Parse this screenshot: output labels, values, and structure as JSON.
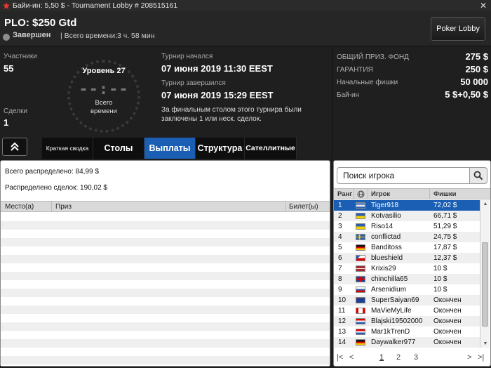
{
  "window": {
    "title": "Байи-ин: 5,50 $ - Tournament Lobby # 208515161",
    "close_label": "✕"
  },
  "header": {
    "name": "PLO: $250 Gtd",
    "status": "Завершен",
    "total_time": "| Всего времени:3 ч. 58 мин",
    "lobby_button": "Poker Lobby"
  },
  "info": {
    "participants_label": "Участники",
    "participants_value": "55",
    "deals_label": "Сделки",
    "deals_value": "1",
    "level": "Уровень 27",
    "timer": "--:--",
    "timer_caption_1": "Всего",
    "timer_caption_2": "времени",
    "started_label": "Турнир начался",
    "started_value": "07 июня 2019   11:30 EEST",
    "ended_label": "Турнир завершился",
    "ended_value": "07 июня 2019   15:29 EEST",
    "note": "За финальным столом этого турнира были заключены 1 или неск. сделок."
  },
  "prize": [
    {
      "label": "ОБЩИЙ ПРИЗ. ФОНД",
      "value": "275 $"
    },
    {
      "label": "ГАРАНТИЯ",
      "value": "250 $"
    },
    {
      "label": "Начальные фишки",
      "value": "50 000"
    },
    {
      "label": "Бай-ин",
      "value": "5 $+0,50 $"
    }
  ],
  "tabs": [
    {
      "label": "Краткая сводка",
      "active": false
    },
    {
      "label": "Столы",
      "active": false
    },
    {
      "label": "Выплаты",
      "active": true
    },
    {
      "label": "Структура",
      "active": false
    },
    {
      "label": "Сателлитные",
      "active": false
    }
  ],
  "payouts": {
    "total_distributed": "Всего распределено: 84,99 $",
    "deal_distributed": "Распределено сделок: 190,02 $",
    "columns": [
      "Место(а)",
      "Приз",
      "Билет(ы)"
    ]
  },
  "players": {
    "search_placeholder": "Поиск игрока",
    "columns": [
      "Ранг",
      "Игрок",
      "Фишки"
    ],
    "rows": [
      {
        "rank": "1",
        "name": "Tiger918",
        "chips": "72,02 $",
        "flag": "gr"
      },
      {
        "rank": "2",
        "name": "Kotvasilio",
        "chips": "66,71 $",
        "flag": "ua"
      },
      {
        "rank": "3",
        "name": "Riso14",
        "chips": "51,29 $",
        "flag": "ua"
      },
      {
        "rank": "4",
        "name": "conflictad",
        "chips": "24,75 $",
        "flag": "se"
      },
      {
        "rank": "5",
        "name": "Banditoss",
        "chips": "17,87 $",
        "flag": "de"
      },
      {
        "rank": "6",
        "name": "blueshield",
        "chips": "12,37 $",
        "flag": "cz"
      },
      {
        "rank": "7",
        "name": "Krixis29",
        "chips": "10 $",
        "flag": "lv"
      },
      {
        "rank": "8",
        "name": "chinchilla65",
        "chips": "10 $",
        "flag": "gb"
      },
      {
        "rank": "9",
        "name": "Arsenidium",
        "chips": "10 $",
        "flag": "ru"
      },
      {
        "rank": "10",
        "name": "SuperSaiyan69",
        "chips": "Окончен",
        "flag": "nz"
      },
      {
        "rank": "11",
        "name": "MaVieMyLife",
        "chips": "Окончен",
        "flag": "ca"
      },
      {
        "rank": "12",
        "name": "Blajski19502000",
        "chips": "Окончен",
        "flag": "hr"
      },
      {
        "rank": "13",
        "name": "Mar1kTrenD",
        "chips": "Окончен",
        "flag": "hr"
      },
      {
        "rank": "14",
        "name": "Daywalker977",
        "chips": "Окончен",
        "flag": "de"
      }
    ],
    "pages": [
      "1",
      "2",
      "3"
    ],
    "current_page": "1"
  },
  "colors": {
    "accent": "#1a5fb4",
    "logo": "#e8372c"
  }
}
